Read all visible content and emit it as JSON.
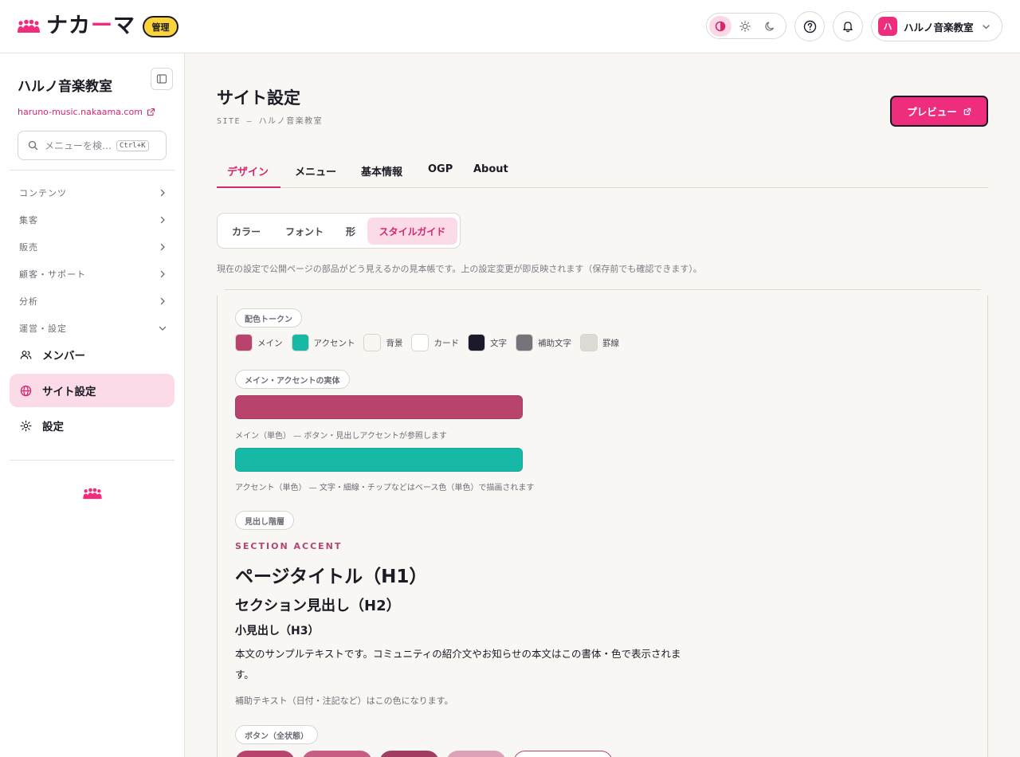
{
  "header": {
    "logo_text_1": "ナカ",
    "logo_text_2": "ー",
    "logo_text_3": "マ",
    "admin_badge": "管理",
    "theme_icons": [
      "contrast-icon",
      "sun-icon",
      "moon-icon"
    ],
    "account": {
      "avatar": "ハ",
      "name": "ハルノ音楽教室"
    }
  },
  "sidebar": {
    "title": "ハルノ音楽教室",
    "url": "haruno-music.nakaama.com",
    "search": {
      "placeholder": "メニューを検…",
      "shortcut": "Ctrl+K"
    },
    "groups": [
      {
        "label": "コンテンツ",
        "expanded": false
      },
      {
        "label": "集客",
        "expanded": false
      },
      {
        "label": "販売",
        "expanded": false
      },
      {
        "label": "顧客・サポート",
        "expanded": false
      },
      {
        "label": "分析",
        "expanded": false
      },
      {
        "label": "運営・設定",
        "expanded": true
      }
    ],
    "items": [
      {
        "label": "メンバー",
        "icon": "members-icon",
        "active": false
      },
      {
        "label": "サイト設定",
        "icon": "globe-icon",
        "active": true
      },
      {
        "label": "設定",
        "icon": "gear-icon",
        "active": false
      }
    ]
  },
  "main": {
    "title": "サイト設定",
    "subtitle": "SITE — ハルノ音楽教室",
    "preview_label": "プレビュー",
    "tabs": [
      "デザイン",
      "メニュー",
      "基本情報",
      "OGP",
      "About"
    ],
    "active_tab": "デザイン",
    "subtabs": [
      "カラー",
      "フォント",
      "形",
      "スタイルガイド"
    ],
    "active_subtab": "スタイルガイド",
    "description": "現在の設定で公開ページの部品がどう見えるかの見本帳です。上の設定変更が即反映されます（保存前でも確認できます）。",
    "styleguide": {
      "tokens_label": "配色トークン",
      "tokens": [
        {
          "label": "メイン",
          "color": "#b8446e"
        },
        {
          "label": "アクセント",
          "color": "#17b8a6"
        },
        {
          "label": "背景",
          "color": "#f8f7f4"
        },
        {
          "label": "カード",
          "color": "#ffffff"
        },
        {
          "label": "文字",
          "color": "#1c1a2a"
        },
        {
          "label": "補助文字",
          "color": "#76737b"
        },
        {
          "label": "罫線",
          "color": "#dedbd5"
        }
      ],
      "entities_label": "メイン・アクセントの実体",
      "main_bar_color": "#b8446e",
      "main_caption": "メイン（単色） — ボタン・見出しアクセントが参照します",
      "accent_bar_color": "#17b8a6",
      "accent_caption": "アクセント（単色） — 文字・細線・チップなどはベース色（単色）で描画されます",
      "headings_label": "見出し階層",
      "section_accent": "SECTION ACCENT",
      "h1": "ページタイトル（H1）",
      "h2": "セクション見出し（H2）",
      "h3": "小見出し（H3）",
      "body": "本文のサンプルテキストです。コミュニティの紹介文やお知らせの本文はこの書体・色で表示されます。",
      "muted": "補助テキスト（日付・注記など）はこの色になります。",
      "buttons_label": "ボタン（全状態）"
    }
  }
}
